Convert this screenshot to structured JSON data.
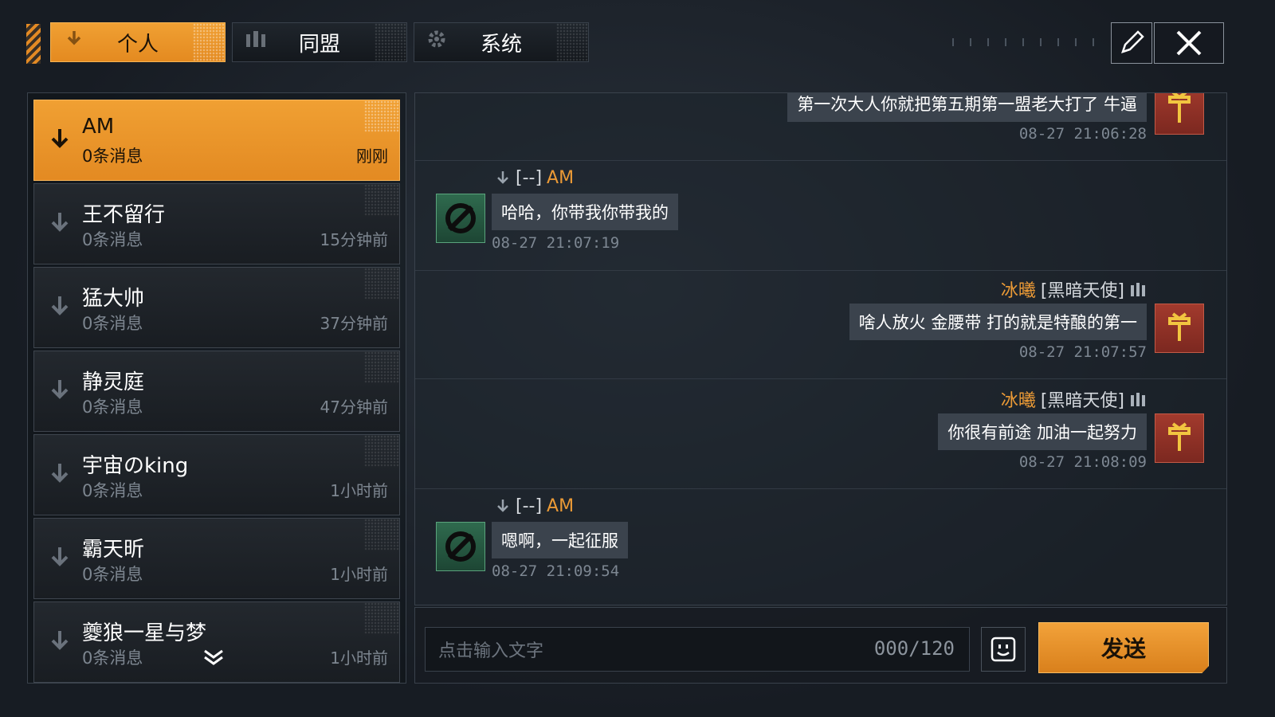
{
  "tabs": [
    {
      "label": "个人",
      "active": true
    },
    {
      "label": "同盟",
      "active": false
    },
    {
      "label": "系统",
      "active": false
    }
  ],
  "contacts": [
    {
      "name": "AM",
      "count": "0条消息",
      "time": "刚刚",
      "active": true
    },
    {
      "name": "王不留行",
      "count": "0条消息",
      "time": "15分钟前"
    },
    {
      "name": "猛大帅",
      "count": "0条消息",
      "time": "37分钟前"
    },
    {
      "name": "静灵庭",
      "count": "0条消息",
      "time": "47分钟前"
    },
    {
      "name": "宇宙のking",
      "count": "0条消息",
      "time": "1小时前"
    },
    {
      "name": "霸天昕",
      "count": "0条消息",
      "time": "1小时前"
    },
    {
      "name": "夔狼一星与梦",
      "count": "0条消息",
      "time": "1小时前"
    }
  ],
  "messages": [
    {
      "side": "right",
      "text": "第一次大人你就把第五期第一盟老大打了 牛逼",
      "time": "08-27 21:06:28"
    },
    {
      "side": "left",
      "sender_tag": "[--]",
      "sender_name": "AM",
      "text": "哈哈，你带我你带我的",
      "time": "08-27 21:07:19"
    },
    {
      "side": "right",
      "sender_name": "冰曦",
      "sender_tag": "[黑暗天使]",
      "text": "啥人放火 金腰带 打的就是特酿的第一",
      "time": "08-27 21:07:57"
    },
    {
      "side": "right",
      "sender_name": "冰曦",
      "sender_tag": "[黑暗天使]",
      "text": "你很有前途 加油一起努力",
      "time": "08-27 21:08:09"
    },
    {
      "side": "left",
      "sender_tag": "[--]",
      "sender_name": "AM",
      "text": "嗯啊，一起征服",
      "time": "08-27 21:09:54"
    }
  ],
  "input": {
    "placeholder": "点击输入文字",
    "counter": "000/120"
  },
  "send_label": "发送",
  "colors": {
    "accent": "#eb9a36",
    "panel": "#1a2028",
    "avatar_left": "#2f6a4e",
    "avatar_right": "#a23a2d"
  },
  "icons": {
    "edit": "pencil-icon",
    "close": "close-icon",
    "emoji": "emoji-icon",
    "rank": "chevron-rank-icon",
    "alliance": "alliance-icon"
  }
}
